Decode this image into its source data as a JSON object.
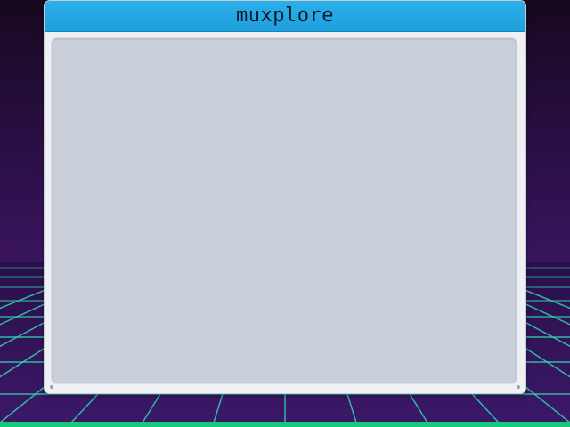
{
  "window": {
    "title": "muxplore"
  },
  "icons": {
    "resize_left": "resize-grip-icon",
    "resize_right": "resize-grip-icon"
  },
  "colors": {
    "titlebar": "#1fa3e0",
    "title_text": "#0c1a2b",
    "window_body": "#eef0f4",
    "content_panel": "#c9d0da",
    "grid_line": "#2fd6b0",
    "bottom_strip": "#18c97a",
    "background_top": "#16081f",
    "background_bottom": "#3a1460"
  },
  "content": {
    "items": []
  }
}
